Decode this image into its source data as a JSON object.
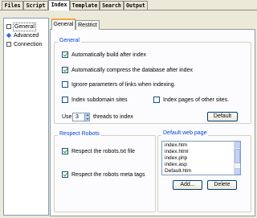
{
  "top_tabs": [
    "Files",
    "Script",
    "Index",
    "Template",
    "Search",
    "Output"
  ],
  "active_top_tab": "Index",
  "tree": {
    "items": [
      "General",
      "Advanced",
      "Connection"
    ]
  },
  "inner_tabs": [
    "General",
    "Restrict"
  ],
  "general_group": {
    "title": "General",
    "options": {
      "auto_build": {
        "label": "Automatically build after index",
        "checked": true
      },
      "auto_compress": {
        "label": "Automatically compress the database after index",
        "checked": true
      },
      "ignore_params": {
        "label": "Ignore parameters of links when indexing.",
        "checked": false
      },
      "index_subdomain": {
        "label": "Index subdomain sites",
        "checked": false
      },
      "index_other_pages": {
        "label": "Index pages of other sites.",
        "checked": false
      }
    },
    "threads": {
      "prefix": "Use",
      "value": "3",
      "suffix": "threads to index"
    },
    "default_button": "Default"
  },
  "robots_group": {
    "title": "Respect Robots",
    "respect_file": {
      "label": "Respect the robots.txt file",
      "checked": true
    },
    "respect_meta": {
      "label": "Respect the robots meta tags",
      "checked": true
    }
  },
  "default_page_group": {
    "title": "Default web page",
    "pages": [
      "index.htm",
      "index.html",
      "index.php",
      "index.asp",
      "Default.htm"
    ],
    "add_button": "Add...",
    "delete_button": "Delete"
  },
  "colors": {
    "accent_orange": "#f6a53a",
    "group_title_blue": "#0046d5",
    "check_green": "#21a121"
  }
}
